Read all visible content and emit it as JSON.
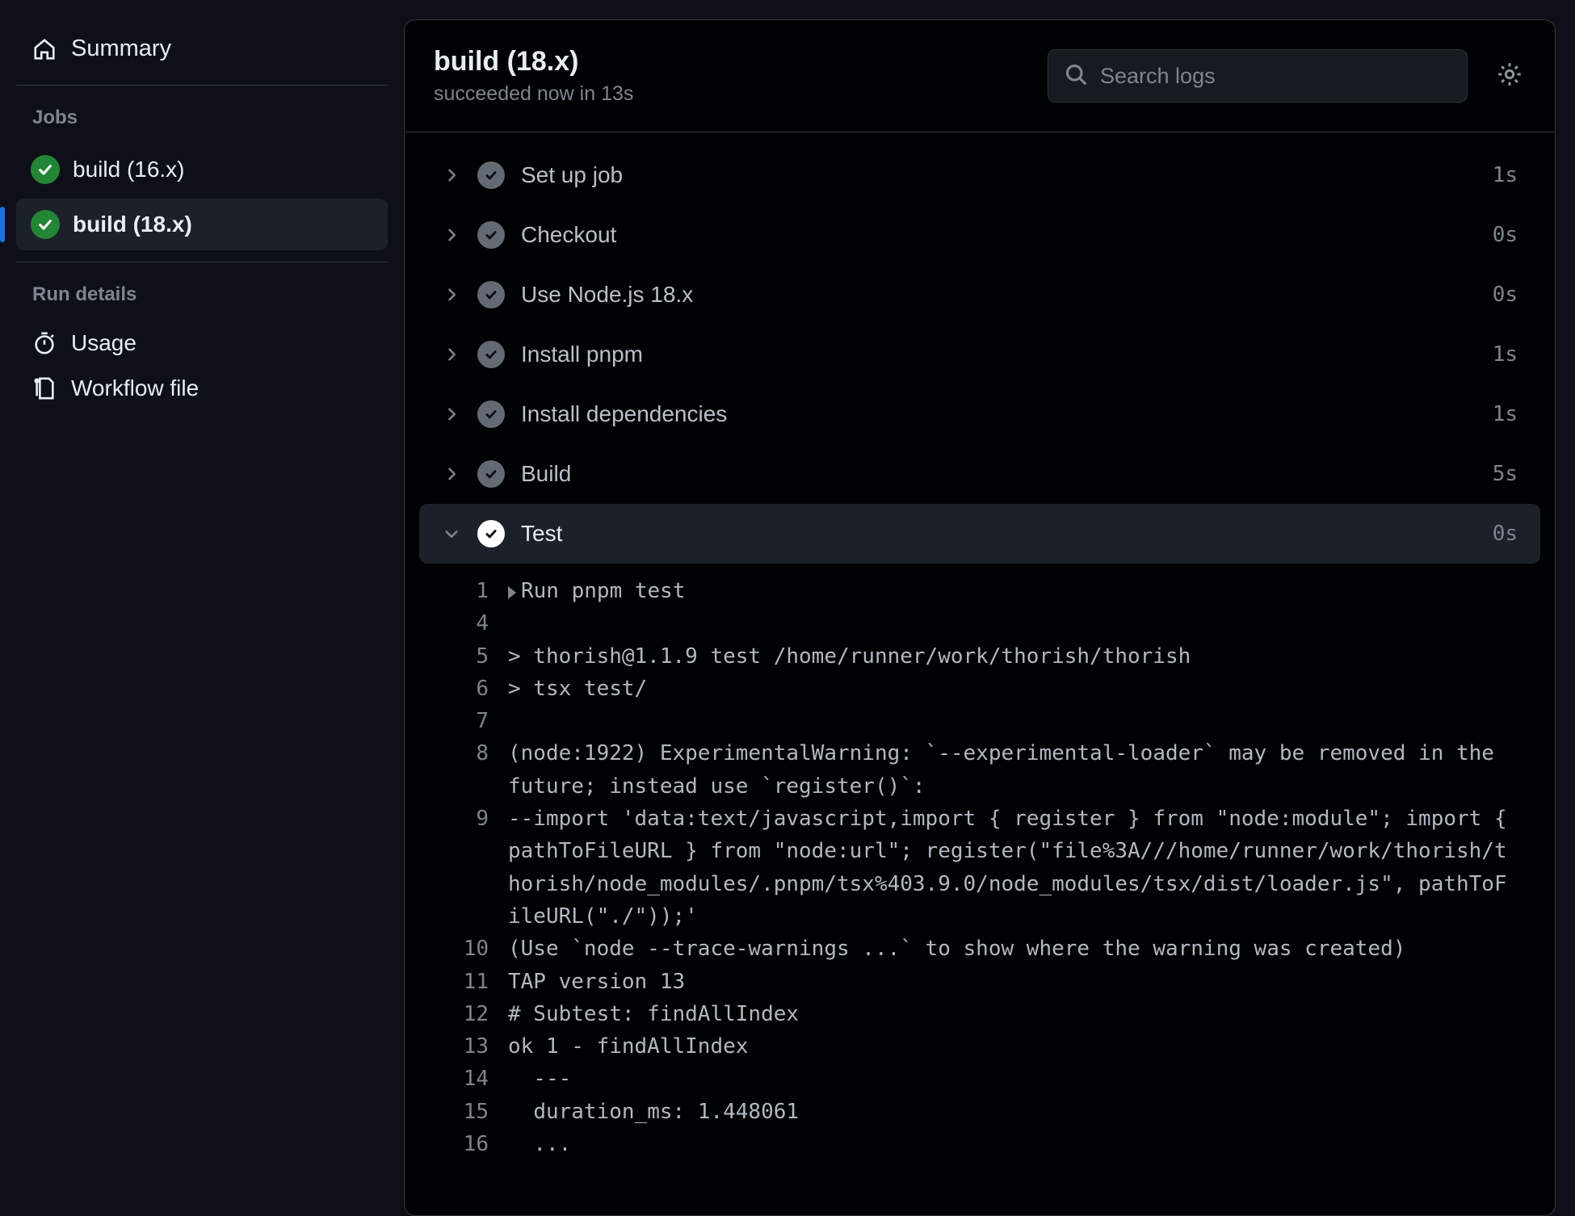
{
  "sidebar": {
    "summary_label": "Summary",
    "jobs_label": "Jobs",
    "jobs": [
      {
        "label": "build (16.x)",
        "active": false
      },
      {
        "label": "build (18.x)",
        "active": true
      }
    ],
    "run_details_label": "Run details",
    "usage_label": "Usage",
    "workflow_file_label": "Workflow file"
  },
  "header": {
    "title": "build (18.x)",
    "subtitle": "succeeded now in 13s",
    "search_placeholder": "Search logs"
  },
  "steps": [
    {
      "name": "Set up job",
      "duration": "1s",
      "expanded": false
    },
    {
      "name": "Checkout",
      "duration": "0s",
      "expanded": false
    },
    {
      "name": "Use Node.js 18.x",
      "duration": "0s",
      "expanded": false
    },
    {
      "name": "Install pnpm",
      "duration": "1s",
      "expanded": false
    },
    {
      "name": "Install dependencies",
      "duration": "1s",
      "expanded": false
    },
    {
      "name": "Build",
      "duration": "5s",
      "expanded": false
    },
    {
      "name": "Test",
      "duration": "0s",
      "expanded": true
    }
  ],
  "log": [
    {
      "n": "1",
      "caret": true,
      "text": "Run pnpm test"
    },
    {
      "n": "4",
      "text": ""
    },
    {
      "n": "5",
      "text": "> thorish@1.1.9 test /home/runner/work/thorish/thorish"
    },
    {
      "n": "6",
      "text": "> tsx test/"
    },
    {
      "n": "7",
      "text": ""
    },
    {
      "n": "8",
      "text": "(node:1922) ExperimentalWarning: `--experimental-loader` may be removed in the future; instead use `register()`:"
    },
    {
      "n": "9",
      "text": "--import 'data:text/javascript,import { register } from \"node:module\"; import { pathToFileURL } from \"node:url\"; register(\"file%3A///home/runner/work/thorish/thorish/node_modules/.pnpm/tsx%403.9.0/node_modules/tsx/dist/loader.js\", pathToFileURL(\"./\"));'"
    },
    {
      "n": "10",
      "text": "(Use `node --trace-warnings ...` to show where the warning was created)"
    },
    {
      "n": "11",
      "text": "TAP version 13"
    },
    {
      "n": "12",
      "text": "# Subtest: findAllIndex"
    },
    {
      "n": "13",
      "text": "ok 1 - findAllIndex"
    },
    {
      "n": "14",
      "text": "  ---"
    },
    {
      "n": "15",
      "text": "  duration_ms: 1.448061"
    },
    {
      "n": "16",
      "text": "  ..."
    }
  ]
}
